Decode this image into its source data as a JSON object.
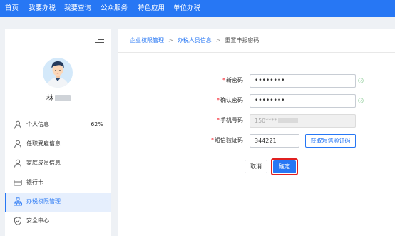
{
  "topnav": {
    "items": [
      "首页",
      "我要办税",
      "我要查询",
      "公众服务",
      "特色应用",
      "单位办税"
    ],
    "color": "#2777f4"
  },
  "sidebar": {
    "user_name": "林",
    "items": [
      {
        "label": "个人信息",
        "icon": "user-icon",
        "percent": "62%"
      },
      {
        "label": "任职受雇信息",
        "icon": "user-icon"
      },
      {
        "label": "家庭成员信息",
        "icon": "user-icon"
      },
      {
        "label": "银行卡",
        "icon": "bank-card-icon"
      },
      {
        "label": "办税权限管理",
        "icon": "org-chart-icon",
        "active": true
      },
      {
        "label": "安全中心",
        "icon": "shield-icon"
      }
    ]
  },
  "breadcrumb": {
    "items": [
      "企业权限管理",
      "办税人员信息",
      "重置申报密码"
    ]
  },
  "form": {
    "new_password": {
      "label": "新密码",
      "value": "••••••••"
    },
    "confirm_password": {
      "label": "确认密码",
      "value": "••••••••"
    },
    "phone": {
      "label": "手机号码",
      "value": "150****"
    },
    "sms_code": {
      "label": "短信验证码",
      "value": "344221"
    },
    "get_code_label": "获取短信验证码",
    "cancel_label": "取消",
    "confirm_label": "确定"
  }
}
